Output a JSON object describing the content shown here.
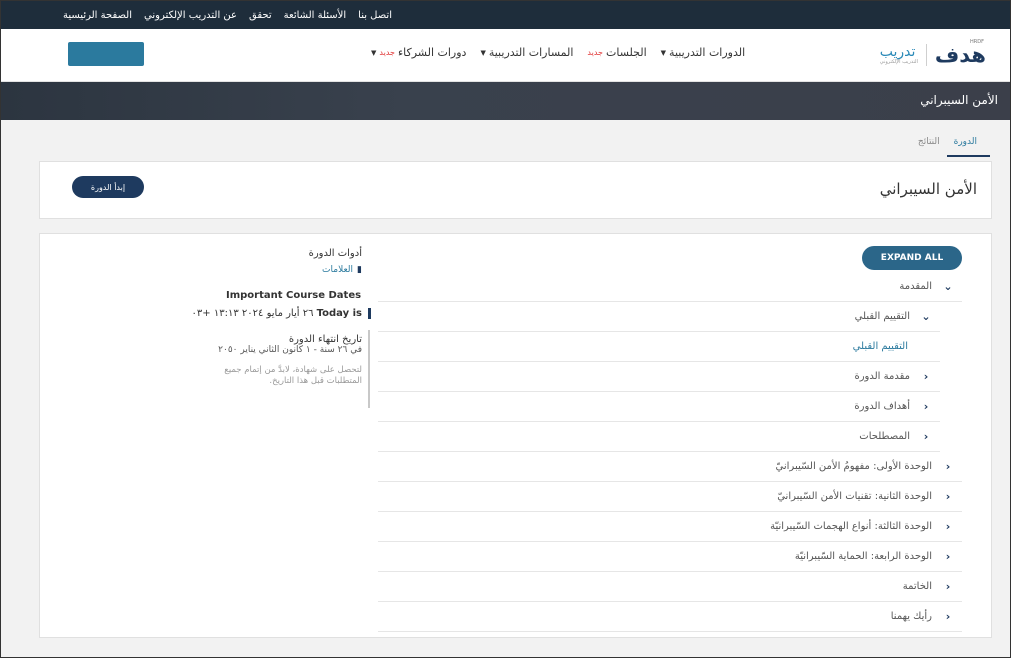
{
  "topbar": {
    "links": [
      "الصفحة الرئيسية",
      "عن التدريب الإلكتروني",
      "تحقق",
      "الأسئلة الشائعة",
      "اتصل بنا"
    ]
  },
  "logo": {
    "brand": "هدف",
    "brand_small": "HRDF",
    "product": "تدريب",
    "product_sub": "التدريب الإلكتروني"
  },
  "nav": {
    "items": [
      {
        "label": "الدورات التدريبية",
        "badge": "",
        "dropdown": true
      },
      {
        "label": "الجلسات",
        "badge": "جديد",
        "dropdown": false
      },
      {
        "label": "المسارات التدريبية",
        "badge": "",
        "dropdown": true
      },
      {
        "label": "دورات الشركاء",
        "badge": "جديد",
        "dropdown": true
      }
    ]
  },
  "banner": {
    "title": "الأمن السيبراني"
  },
  "tabs": [
    {
      "label": "الدورة",
      "active": true
    },
    {
      "label": "النتائج",
      "active": false
    }
  ],
  "course": {
    "title": "الأمن السيبراني",
    "start_label": "إبدأ الدورة"
  },
  "outline": {
    "expand_label": "EXPAND ALL",
    "rows": [
      {
        "level": 1,
        "label": "المقدمة",
        "expanded": true
      },
      {
        "level": 2,
        "label": "التقييم القبلي",
        "expanded": true
      },
      {
        "level": 3,
        "label": "التقييم القبلي"
      },
      {
        "level": 2,
        "label": "مقدمة الدورة",
        "expanded": false
      },
      {
        "level": 2,
        "label": "أهداف الدورة",
        "expanded": false
      },
      {
        "level": 2,
        "label": "المصطلحات",
        "expanded": false
      },
      {
        "level": 1,
        "label": "الوحدة الأولى: مفهومُ الأمن السّيبرانيّ",
        "expanded": false
      },
      {
        "level": 1,
        "label": "الوحدة الثانية: تقنيات الأمن السّيبرانيّ",
        "expanded": false
      },
      {
        "level": 1,
        "label": "الوحدة الثالثة: أنواع الهجمات السّيبرانيّة",
        "expanded": false
      },
      {
        "level": 1,
        "label": "الوحدة الرابعة: الحماية السّيبرانيّة",
        "expanded": false
      },
      {
        "level": 1,
        "label": "الخاتمة",
        "expanded": false
      },
      {
        "level": 1,
        "label": "رأيك يهمنا",
        "expanded": false
      }
    ]
  },
  "tools": {
    "title": "أدوات الدورة",
    "bookmarks": "العلامات"
  },
  "dates": {
    "title": "Important Course Dates",
    "today_label": "Today is",
    "today_value": "٢٦ أيار مايو ٢٠٢٤ ١٣:١٣ +٠٣",
    "end_title": "تاريخ انتهاء الدورة",
    "end_value": "في ٢٦ سنة - ١ كانون الثاني يناير ٢٠٥٠",
    "note": "لتحصل على شهادة، لابدَّ من إتمام جميع المتطلبات قبل هذا التاريخ."
  }
}
